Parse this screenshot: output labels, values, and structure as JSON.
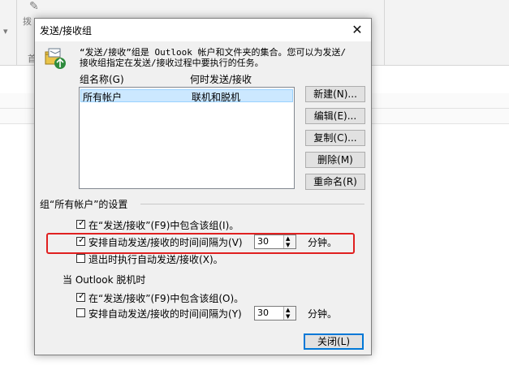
{
  "dialog": {
    "title": "发送/接收组",
    "description_line1": "“发送/接收”组是 Outlook 帐户和文件夹的集合。您可以为发送/",
    "description_line2": "接收组指定在发送/接收过程中要执行的任务。",
    "col_group_name": "组名称(G)",
    "col_when": "何时发送/接收",
    "groups": [
      {
        "name": "所有帐户",
        "when": "联机和脱机"
      }
    ],
    "buttons": {
      "new": "新建(N)...",
      "edit": "编辑(E)...",
      "copy": "复制(C)...",
      "delete": "删除(M)",
      "rename": "重命名(R)",
      "close": "关闭(L)"
    },
    "settings_section": "组“所有帐户”的设置",
    "online": {
      "include_label": "在“发送/接收”(F9)中包含该组(I)。",
      "include_checked": true,
      "schedule_label": "安排自动发送/接收的时间间隔为(V)",
      "schedule_checked": true,
      "schedule_value": "30",
      "schedule_unit": "分钟。",
      "exit_label": "退出时执行自动发送/接收(X)。",
      "exit_checked": false
    },
    "offline_section": "当 Outlook 脱机时",
    "offline": {
      "include_label": "在“发送/接收”(F9)中包含该组(O)。",
      "include_checked": true,
      "schedule_label": "安排自动发送/接收的时间间隔为(Y)",
      "schedule_checked": false,
      "schedule_value": "30",
      "schedule_unit": "分钟。"
    }
  },
  "background": {
    "ribbon_fragment": "拨",
    "ribbon_fragment2": "首"
  },
  "colors": {
    "highlight": "#e02020",
    "selection": "#cce8ff",
    "accent": "#0078d7"
  }
}
